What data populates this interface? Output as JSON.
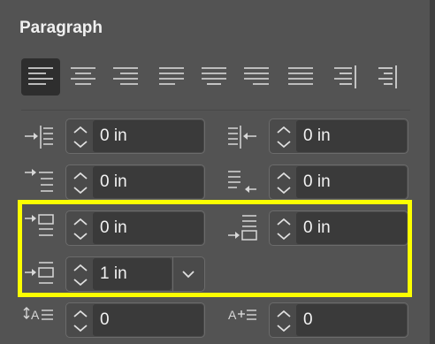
{
  "panel": {
    "title": "Paragraph"
  },
  "alignment": {
    "buttons": [
      {
        "name": "align-left-icon",
        "selected": true
      },
      {
        "name": "align-center-icon",
        "selected": false
      },
      {
        "name": "align-right-icon",
        "selected": false
      },
      {
        "name": "justify-last-left-icon",
        "selected": false
      },
      {
        "name": "justify-last-center-icon",
        "selected": false
      },
      {
        "name": "justify-last-right-icon",
        "selected": false
      },
      {
        "name": "justify-all-icon",
        "selected": false
      },
      {
        "name": "align-towards-spine-icon",
        "selected": false
      },
      {
        "name": "align-away-from-spine-icon",
        "selected": false
      }
    ]
  },
  "fields": {
    "left_indent": "0 in",
    "right_indent": "0 in",
    "first_line_indent": "0 in",
    "last_line_right_indent": "0 in",
    "space_before": "0 in",
    "space_after": "0 in",
    "drop_cap_lines": "1 in",
    "drop_cap_chars": "0",
    "drop_cap_extra": "0"
  },
  "colors": {
    "highlight": "#fbff00",
    "panel_bg": "#535353"
  }
}
